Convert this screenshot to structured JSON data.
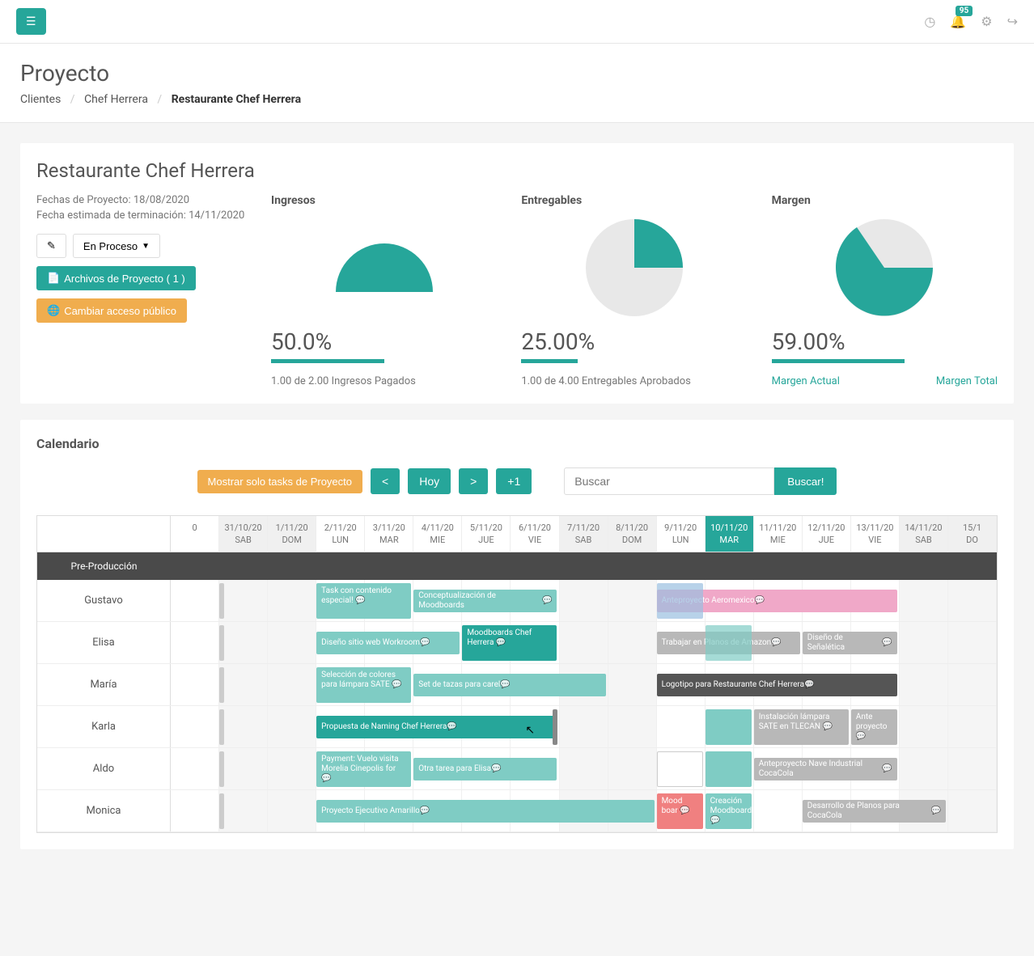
{
  "topbar": {
    "notification_count": "95"
  },
  "header": {
    "title": "Proyecto",
    "breadcrumb": {
      "l1": "Clientes",
      "l2": "Chef Herrera",
      "l3": "Restaurante Chef Herrera"
    }
  },
  "project": {
    "name": "Restaurante Chef Herrera",
    "start_label": "Fechas de Proyecto: 18/08/2020",
    "end_label": "Fecha estimada de terminación: 14/11/2020",
    "status": "En Proceso",
    "files_btn": "Archivos de Proyecto ( 1 )",
    "public_btn": "Cambiar acceso público"
  },
  "metrics": {
    "ingresos": {
      "label": "Ingresos",
      "value": "50.0%",
      "sub": "1.00 de 2.00 Ingresos Pagados"
    },
    "entregables": {
      "label": "Entregables",
      "value": "25.00%",
      "sub": "1.00 de 4.00 Entregables Aprobados"
    },
    "margen": {
      "label": "Margen",
      "value": "59.00%",
      "link1": "Margen Actual",
      "link2": "Margen Total"
    }
  },
  "calendar": {
    "title": "Calendario",
    "filter_btn": "Mostrar solo tasks de Proyecto",
    "prev": "<",
    "today": "Hoy",
    "next": ">",
    "plus1": "+1",
    "search_placeholder": "Buscar",
    "search_btn": "Buscar!",
    "section": "Pre-Producción",
    "days": [
      {
        "date": "0",
        "dow": ""
      },
      {
        "date": "31/10/20",
        "dow": "SAB"
      },
      {
        "date": "1/11/20",
        "dow": "DOM"
      },
      {
        "date": "2/11/20",
        "dow": "LUN"
      },
      {
        "date": "3/11/20",
        "dow": "MAR"
      },
      {
        "date": "4/11/20",
        "dow": "MIE"
      },
      {
        "date": "5/11/20",
        "dow": "JUE"
      },
      {
        "date": "6/11/20",
        "dow": "VIE"
      },
      {
        "date": "7/11/20",
        "dow": "SAB"
      },
      {
        "date": "8/11/20",
        "dow": "DOM"
      },
      {
        "date": "9/11/20",
        "dow": "LUN"
      },
      {
        "date": "10/11/20",
        "dow": "MAR"
      },
      {
        "date": "11/11/20",
        "dow": "MIE"
      },
      {
        "date": "12/11/20",
        "dow": "JUE"
      },
      {
        "date": "13/11/20",
        "dow": "VIE"
      },
      {
        "date": "14/11/20",
        "dow": "SAB"
      },
      {
        "date": "15/1",
        "dow": "DO"
      }
    ],
    "people": [
      "Gustavo",
      "Elisa",
      "María",
      "Karla",
      "Aldo",
      "Monica"
    ],
    "tasks": {
      "gustavo": [
        {
          "text": "Task con contenido especial!",
          "color": "#7fccc4"
        },
        {
          "text": "Conceptualización de Moodboards",
          "color": "#7fccc4"
        },
        {
          "text": "Anteproyecto Aeromexico",
          "color": "#f08080"
        }
      ],
      "elisa": [
        {
          "text": "Diseño sitio web Workroom",
          "color": "#7fccc4"
        },
        {
          "text": "Moodboards Chef Herrera",
          "color": "#26a69a"
        },
        {
          "text": "Trabajar en Planos de Amazon",
          "color": "#b8b8b8"
        },
        {
          "text": "Diseño de Señalética",
          "color": "#b8b8b8"
        }
      ],
      "maria": [
        {
          "text": "Selección de colores para lámpara SATE",
          "color": "#7fccc4"
        },
        {
          "text": "Set de tazas para carel",
          "color": "#7fccc4"
        },
        {
          "text": "Logotipo para Restaurante Chef Herrera",
          "color": "#555"
        }
      ],
      "karla": [
        {
          "text": "Propuesta de Naming Chef Herrera",
          "color": "#26a69a"
        },
        {
          "text": "Instalación lámpara SATE en TLECAN",
          "color": "#b8b8b8"
        },
        {
          "text": "Ante proyecto",
          "color": "#b8b8b8"
        }
      ],
      "aldo": [
        {
          "text": "Payment: Vuelo visita Morelia Cinepolis for",
          "color": "#7fccc4"
        },
        {
          "text": "Otra tarea para Elisa",
          "color": "#7fccc4"
        },
        {
          "text": "Anteproyecto Nave Industrial CocaCola",
          "color": "#b8b8b8"
        }
      ],
      "monica": [
        {
          "text": "Proyecto Ejecutivo Amarillo",
          "color": "#7fccc4"
        },
        {
          "text": "Mood boar",
          "color": "#f08080"
        },
        {
          "text": "Creación Moodboards",
          "color": "#7fccc4"
        },
        {
          "text": "Desarrollo de Planos para CocaCola",
          "color": "#b8b8b8"
        }
      ]
    }
  },
  "chart_data": [
    {
      "type": "pie",
      "title": "Ingresos",
      "values": [
        50,
        50
      ],
      "colors": [
        "#26a69a",
        "#e8e8e8"
      ],
      "note": "rendered as half-donut (gauge)"
    },
    {
      "type": "pie",
      "title": "Entregables",
      "values": [
        25,
        75
      ],
      "colors": [
        "#26a69a",
        "#e8e8e8"
      ]
    },
    {
      "type": "pie",
      "title": "Margen",
      "values": [
        59,
        41
      ],
      "colors": [
        "#26a69a",
        "#e8e8e8"
      ]
    }
  ]
}
